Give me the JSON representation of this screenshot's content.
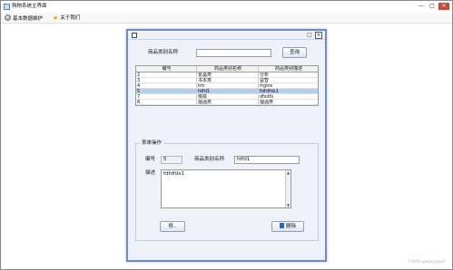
{
  "window": {
    "title": "购物系统主界面",
    "minimize": "—",
    "maximize": "□",
    "close": "✕"
  },
  "menubar": {
    "items": [
      {
        "label": "基本数据维护",
        "icon": "data-icon"
      },
      {
        "label": "关于我们",
        "icon": "star-icon"
      }
    ]
  },
  "internal_frame": {
    "maximize": "□",
    "close": "✕",
    "search": {
      "label": "商品类别名称",
      "value": "",
      "button": "查询"
    },
    "table": {
      "columns": [
        "编号",
        "商品类别名称",
        "商品类别描述"
      ],
      "rows": [
        [
          "2",
          "雀晶类",
          "分析"
        ],
        [
          "3",
          "书本类",
          "益智"
        ],
        [
          "4",
          "trtr",
          "rtgtre"
        ],
        [
          "5",
          "fdfd1",
          "fdfdfdx1"
        ],
        [
          "7",
          "像底",
          "dfsdfs"
        ],
        [
          "8",
          "烟酒类",
          "烟酒类"
        ]
      ],
      "selected_row": 3
    },
    "form": {
      "group_title": "表单操作",
      "id_label": "编号",
      "id_value": "5",
      "name_label": "商品类别名称",
      "name_value": "fdfd1",
      "desc_label": "描述",
      "desc_value": "fdfdfdx1",
      "modify_button": "修..",
      "delete_button": "删除"
    }
  },
  "footer": {
    "text": "CSDN @wjwyjwyd"
  }
}
